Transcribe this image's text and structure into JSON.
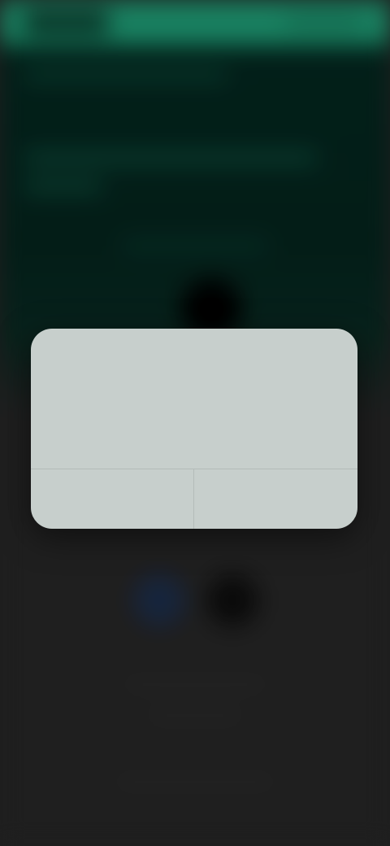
{
  "dialog": {
    "title": "",
    "message": "",
    "cancel_label": "",
    "confirm_label": ""
  },
  "colors": {
    "status_bar": "#1f9d76",
    "hero_background": "#03271f",
    "page_background": "#262626",
    "dialog_background": "#c7cfcc"
  }
}
